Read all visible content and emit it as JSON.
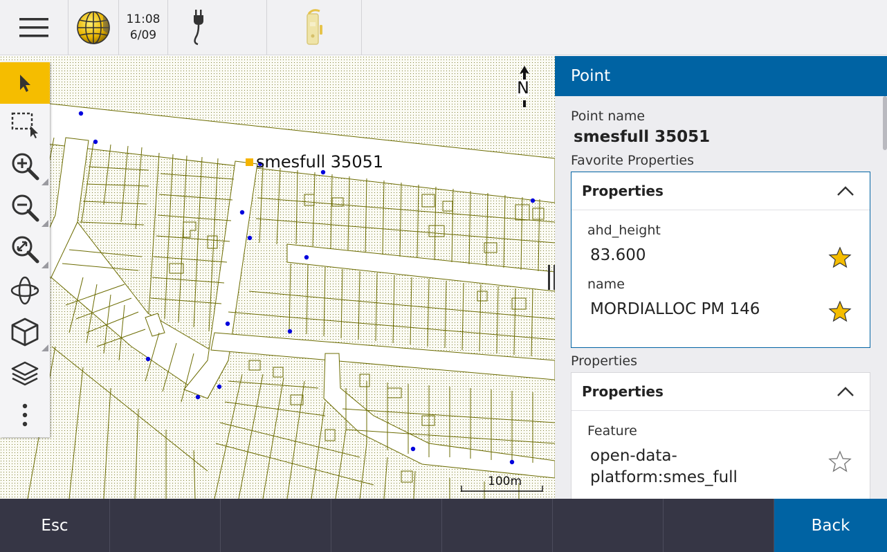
{
  "status": {
    "time": "11:08",
    "date": "6/09"
  },
  "map": {
    "selected_point_label": "smesfull 35051",
    "north_label": "N",
    "scale_label": "100m"
  },
  "toolbar": {
    "tools": [
      "select-arrow-icon",
      "box-select-icon",
      "zoom-in-icon",
      "zoom-out-icon",
      "zoom-extents-icon",
      "orbit-icon",
      "cube-3d-icon",
      "layers-icon",
      "more-vertical-icon"
    ]
  },
  "panel": {
    "title": "Point",
    "point_name_label": "Point name",
    "point_name_value": "smesfull 35051",
    "favorites_label": "Favorite Properties",
    "favorites_card_title": "Properties",
    "favorites": [
      {
        "label": "ahd_height",
        "value": "83.600",
        "favorite": true
      },
      {
        "label": "name",
        "value": "MORDIALLOC PM 146",
        "favorite": true
      }
    ],
    "properties_label": "Properties",
    "properties_card_title": "Properties",
    "feature_label": "Feature",
    "feature_value_line1": "open-data-",
    "feature_value_line2": "platform:smes_full",
    "feature_favorite": false
  },
  "bottombar": {
    "esc_label": "Esc",
    "back_label": "Back"
  },
  "colors": {
    "accent": "#0063a3",
    "active_tool": "#f5bd00",
    "bottombar": "#363645",
    "parcel_lines": "#6b6b00",
    "survey_points": "#0000dd",
    "selected_point": "#f5b400",
    "star_on": "#f5bd00"
  }
}
